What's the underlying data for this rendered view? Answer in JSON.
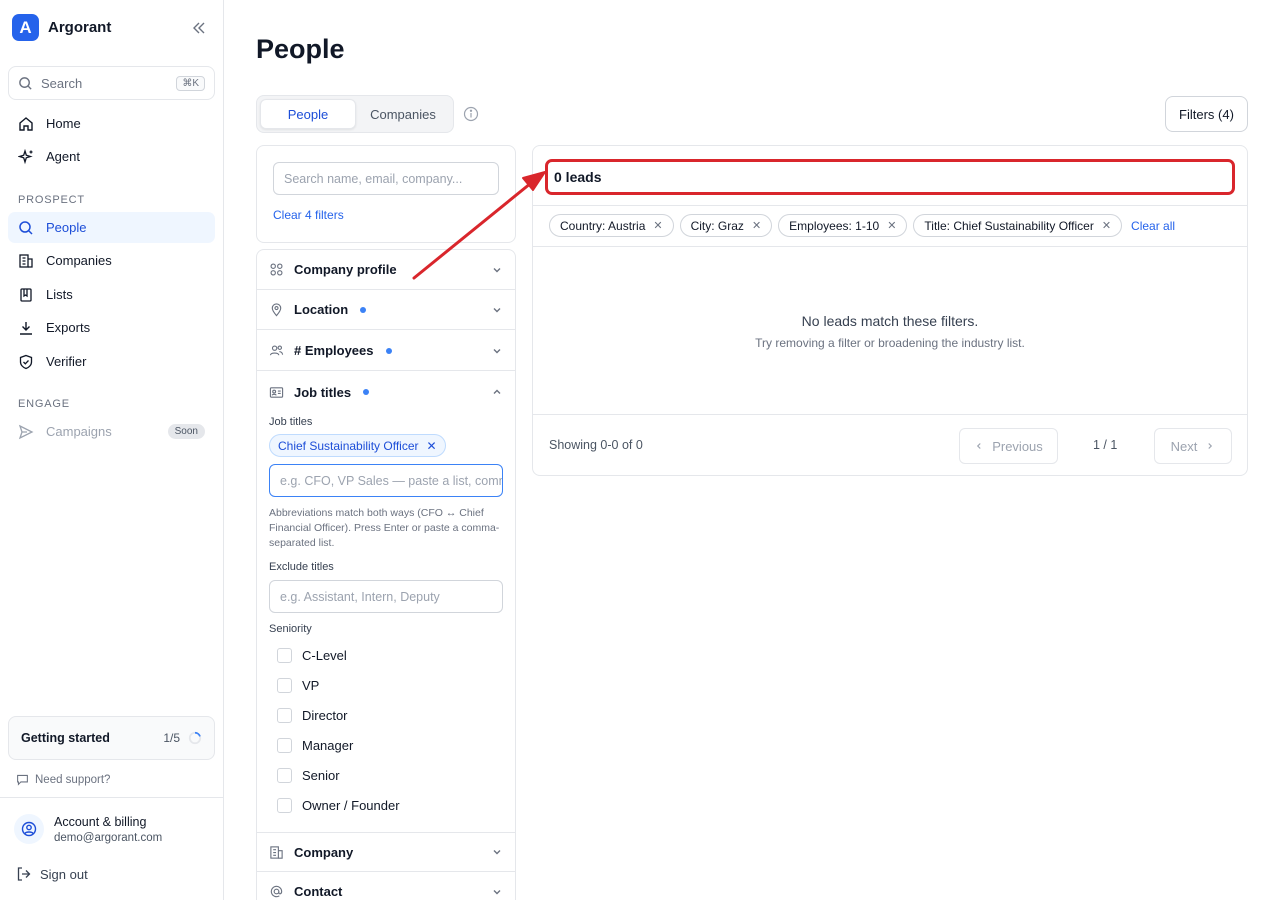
{
  "app": {
    "name": "Argorant",
    "logo_letter": "A"
  },
  "sidebar": {
    "search": {
      "label": "Search",
      "shortcut": "⌘K"
    },
    "items": [
      {
        "label": "Home",
        "icon": "home-icon"
      },
      {
        "label": "Agent",
        "icon": "sparkle-icon"
      },
      {
        "label": "People",
        "icon": "search-icon",
        "active": true
      },
      {
        "label": "Companies",
        "icon": "building-icon"
      },
      {
        "label": "Lists",
        "icon": "book-icon"
      },
      {
        "label": "Exports",
        "icon": "download-icon"
      },
      {
        "label": "Verifier",
        "icon": "shield-icon"
      },
      {
        "label": "Campaigns",
        "icon": "send-icon",
        "badge": "Soon",
        "disabled": true
      }
    ],
    "sections": {
      "prospect": "PROSPECT",
      "engage": "ENGAGE"
    },
    "getting_started": {
      "label": "Getting started",
      "progress": "1/5"
    },
    "support": "Need support?",
    "account": {
      "title": "Account & billing",
      "email": "demo@argorant.com"
    },
    "sign_out": "Sign out"
  },
  "main": {
    "title": "People",
    "tabs": [
      {
        "label": "People",
        "active": true
      },
      {
        "label": "Companies"
      }
    ],
    "filters_button": "Filters (4)",
    "search": {
      "placeholder": "Search name, email, company...",
      "clear_filters": "Clear 4 filters"
    },
    "filter_sections": {
      "company_profile": "Company profile",
      "location": "Location",
      "employees": "# Employees",
      "job_titles": "Job titles",
      "company": "Company",
      "contact": "Contact"
    },
    "job_titles": {
      "label": "Job titles",
      "selected": "Chief Sustainability Officer",
      "input_placeholder": "e.g. CFO, VP Sales — paste a list, comma",
      "hint": "Abbreviations match both ways (CFO ↔ Chief Financial Officer). Press Enter or paste a comma-separated list.",
      "exclude_label": "Exclude titles",
      "exclude_placeholder": "e.g. Assistant, Intern, Deputy",
      "seniority_label": "Seniority",
      "seniority": [
        "C-Level",
        "VP",
        "Director",
        "Manager",
        "Senior",
        "Owner / Founder"
      ]
    },
    "results": {
      "count": "0 leads",
      "chips": [
        "Country: Austria",
        "City: Graz",
        "Employees: 1-10",
        "Title: Chief Sustainability Officer"
      ],
      "clear_all": "Clear all",
      "empty_title": "No leads match these filters.",
      "empty_subtitle": "Try removing a filter or broadening the industry list.",
      "showing": "Showing 0-0 of 0",
      "previous": "Previous",
      "page": "1 / 1",
      "next": "Next"
    }
  },
  "colors": {
    "accent": "#2563eb",
    "annotation": "#d9262c"
  }
}
